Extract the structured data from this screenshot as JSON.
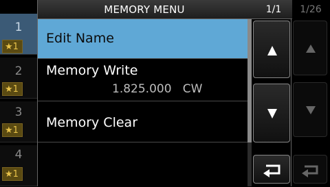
{
  "dialog": {
    "title": "MEMORY MENU",
    "page": "1/1",
    "items": [
      {
        "label": "Edit Name",
        "sub": ""
      },
      {
        "label": "Memory Write",
        "sub": "1.825.000   CW"
      },
      {
        "label": "Memory Clear",
        "sub": ""
      }
    ],
    "up_icon": "triangle-up-icon",
    "down_icon": "triangle-down-icon",
    "return_icon": "return-icon"
  },
  "channels": [
    {
      "num": "1",
      "group": "★1"
    },
    {
      "num": "2",
      "group": "★1"
    },
    {
      "num": "3",
      "group": "★1"
    },
    {
      "num": "4",
      "group": "★1"
    }
  ],
  "right_panel": {
    "page": "1/26"
  },
  "colors": {
    "selection": "#5fa8d6",
    "star": "#e7c24a"
  }
}
